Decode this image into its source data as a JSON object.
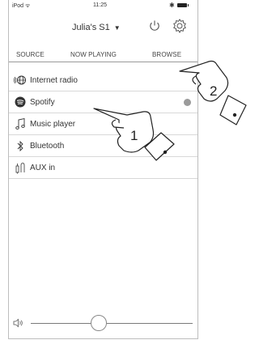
{
  "status_bar": {
    "carrier": "iPod ᯤ",
    "time": "11:25"
  },
  "header": {
    "speaker_name": "Julia's S1"
  },
  "tabs": [
    {
      "label": "SOURCE"
    },
    {
      "label": "NOW PLAYING"
    },
    {
      "label": "BROWSE"
    }
  ],
  "sources": [
    {
      "label": "Internet radio",
      "icon": "internet-radio-icon"
    },
    {
      "label": "Spotify",
      "icon": "spotify-icon",
      "selected": true
    },
    {
      "label": "Music player",
      "icon": "music-note-icon"
    },
    {
      "label": "Bluetooth",
      "icon": "bluetooth-icon"
    },
    {
      "label": "AUX in",
      "icon": "aux-cable-icon"
    }
  ],
  "volume": {
    "level": 0.42
  },
  "callouts": {
    "one": "1",
    "two": "2"
  }
}
